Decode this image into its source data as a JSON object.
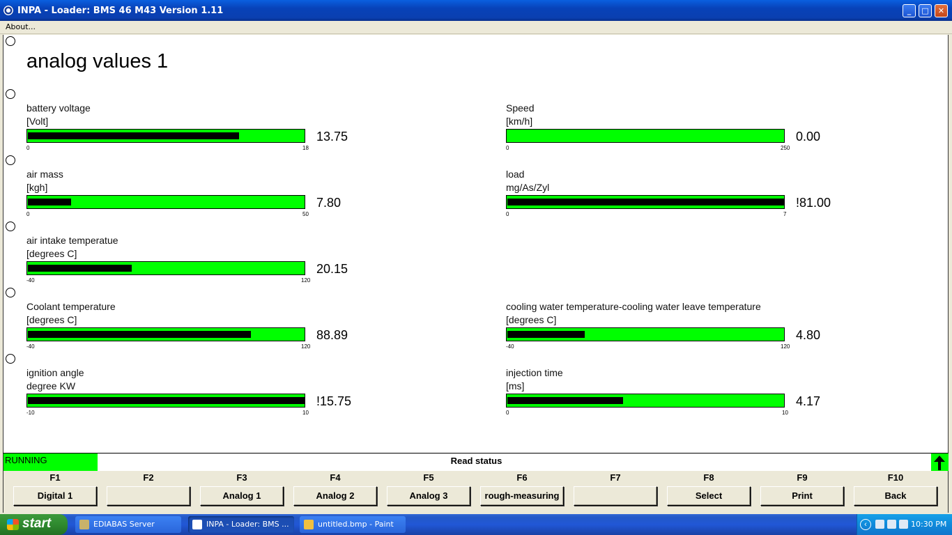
{
  "window": {
    "title": "INPA - Loader:  BMS 46 M43 Version 1.11",
    "minimize": "_",
    "maximize": "□",
    "close": "✕"
  },
  "menu": {
    "about": "About..."
  },
  "page": {
    "title": "analog values 1"
  },
  "gauges": [
    {
      "label": "battery voltage",
      "unit": "[Volt]",
      "min": "0",
      "max": "18",
      "value": "13.75",
      "fraction": 0.764
    },
    {
      "label": "Speed",
      "unit": "[km/h]",
      "min": "0",
      "max": "250",
      "value": "0.00",
      "fraction": 0.0
    },
    {
      "label": "air mass",
      "unit": "[kgh]",
      "min": "0",
      "max": "50",
      "value": "7.80",
      "fraction": 0.156
    },
    {
      "label": "load",
      "unit": "mg/As/Zyl",
      "min": "0",
      "max": "7",
      "value": "!81.00",
      "fraction": 1.0
    },
    {
      "label": "air intake temperatue",
      "unit": "[degrees C]",
      "min": "-40",
      "max": "120",
      "value": "20.15",
      "fraction": 0.376
    },
    {
      "label": "Coolant temperature",
      "unit": "[degrees C]",
      "min": "-40",
      "max": "120",
      "value": "88.89",
      "fraction": 0.806
    },
    {
      "label": "cooling water temperature-cooling water leave temperature",
      "unit": "[degrees C]",
      "min": "-40",
      "max": "120",
      "value": "4.80",
      "fraction": 0.28
    },
    {
      "label": "ignition angle",
      "unit": "degree KW",
      "min": "-10",
      "max": "10",
      "value": "!15.75",
      "fraction": 1.0
    },
    {
      "label": "injection time",
      "unit": "[ms]",
      "min": "0",
      "max": "10",
      "value": "4.17",
      "fraction": 0.417
    }
  ],
  "status": {
    "state": "RUNNING",
    "message": "Read status"
  },
  "fkeys": [
    {
      "key": "F1",
      "label": "Digital 1"
    },
    {
      "key": "F2",
      "label": ""
    },
    {
      "key": "F3",
      "label": "Analog 1"
    },
    {
      "key": "F4",
      "label": "Analog 2"
    },
    {
      "key": "F5",
      "label": "Analog 3"
    },
    {
      "key": "F6",
      "label": "rough-measuring"
    },
    {
      "key": "F7",
      "label": ""
    },
    {
      "key": "F8",
      "label": "Select"
    },
    {
      "key": "F9",
      "label": "Print"
    },
    {
      "key": "F10",
      "label": "Back"
    }
  ],
  "taskbar": {
    "start": "start",
    "tasks": [
      {
        "label": "EDIABAS Server",
        "icon": "ediabas-icon"
      },
      {
        "label": "INPA - Loader:  BMS ...",
        "icon": "inpa-icon"
      },
      {
        "label": "untitled.bmp - Paint",
        "icon": "paint-icon"
      }
    ],
    "clock": "10:30 PM"
  },
  "colors": {
    "bar": "#00ff00",
    "fill": "#000000",
    "status": "#00ff00"
  }
}
